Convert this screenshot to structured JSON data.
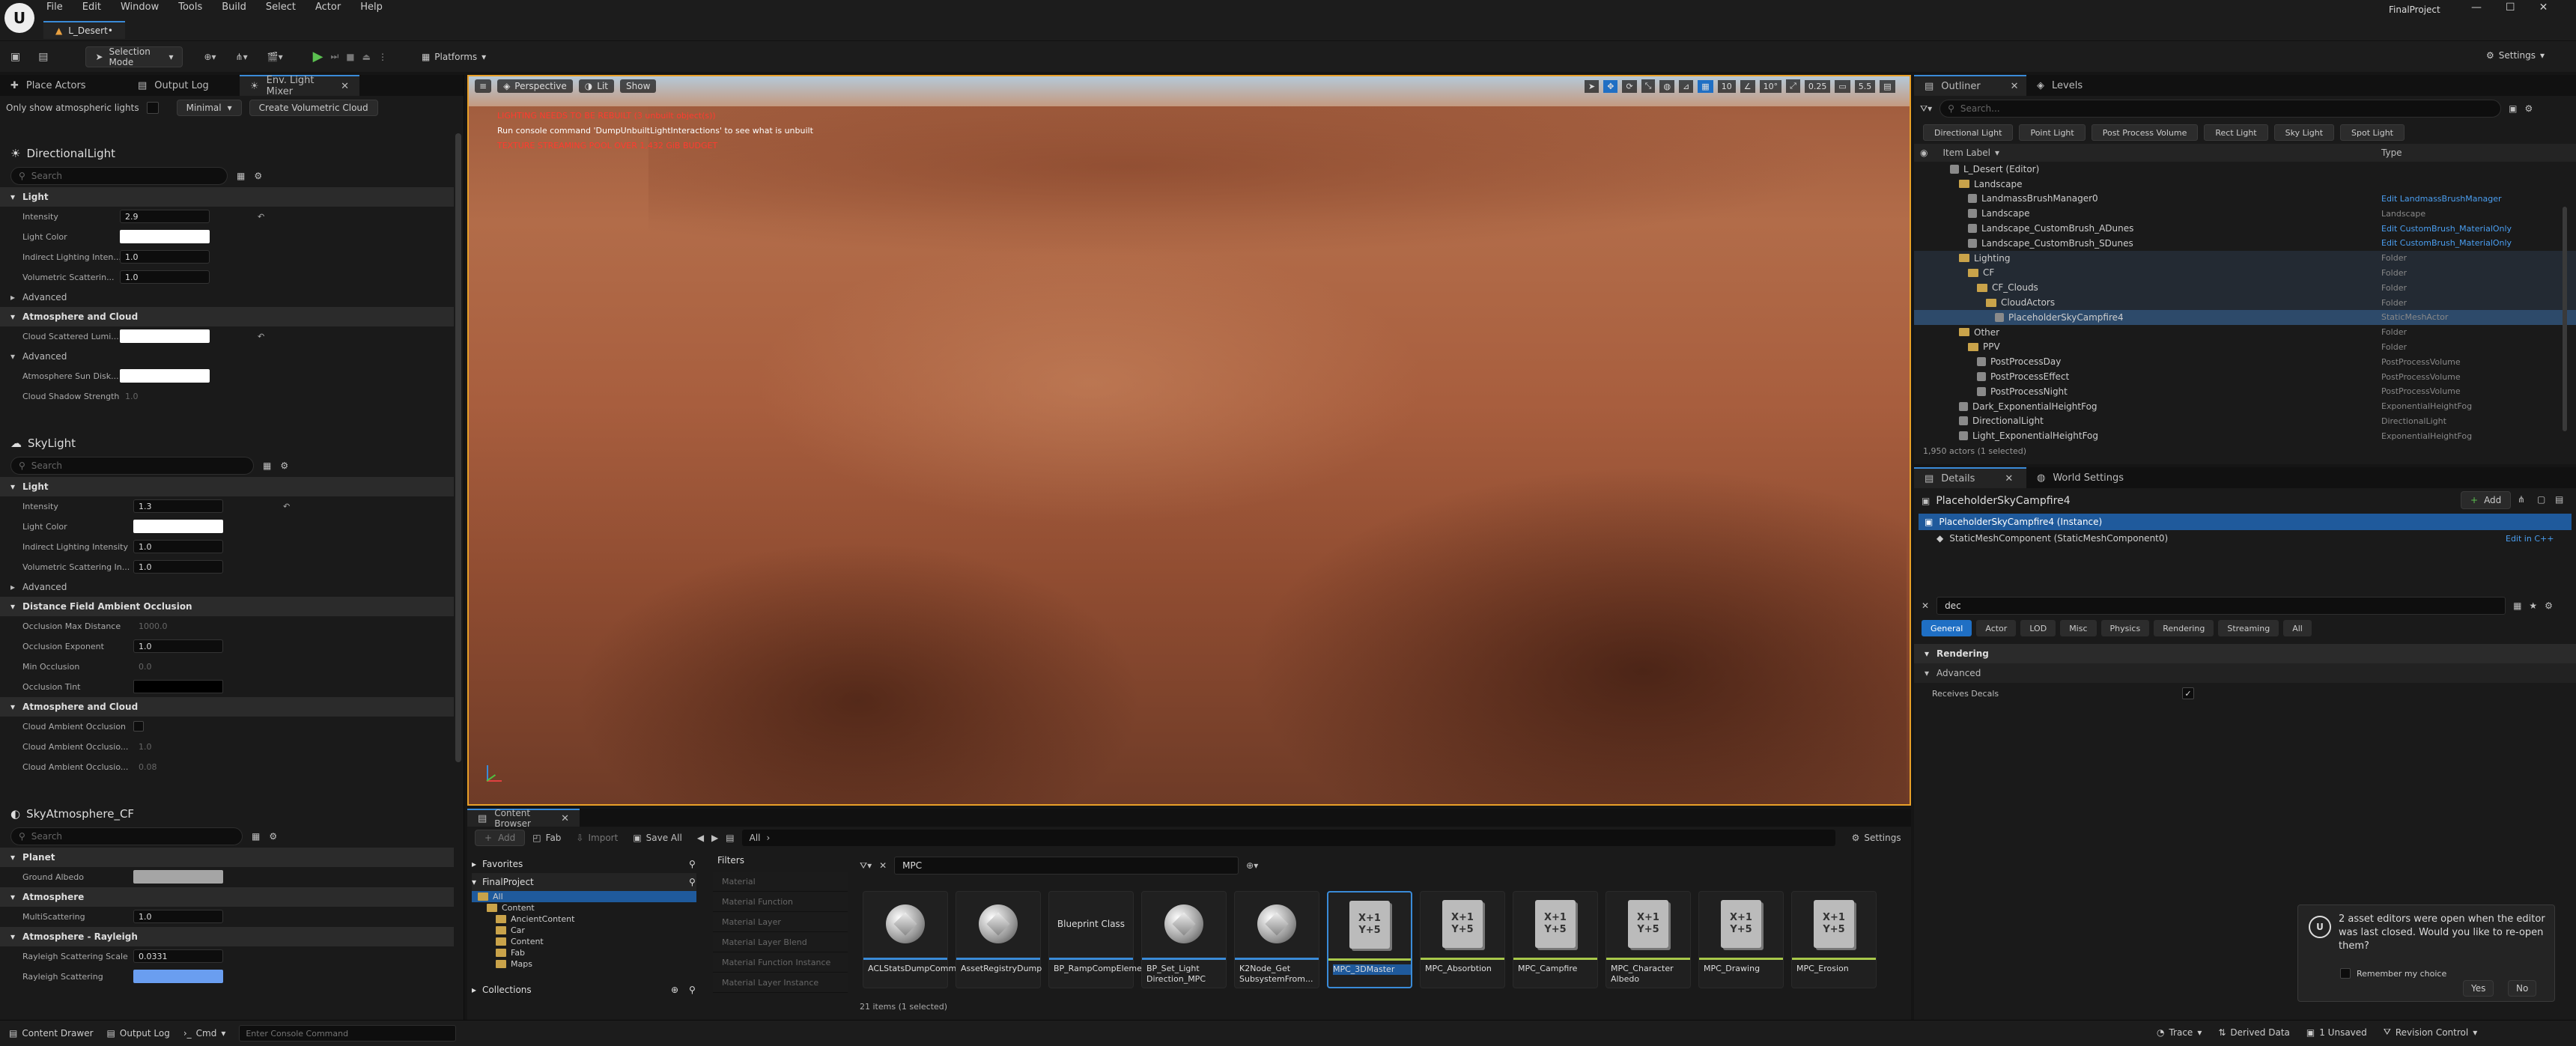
{
  "menu": [
    "File",
    "Edit",
    "Window",
    "Tools",
    "Build",
    "Select",
    "Actor",
    "Help"
  ],
  "level_tab": "L_Desert•",
  "project_name": "FinalProject",
  "toolbar": {
    "selection_mode": "Selection Mode",
    "platforms": "Platforms",
    "settings": "Settings"
  },
  "left_tabs": [
    "Place Actors",
    "Output Log",
    "Env. Light Mixer"
  ],
  "left_opts": {
    "atmo_label": "Only show atmospheric lights",
    "minimal": "Minimal",
    "create_cloud": "Create Volumetric Cloud"
  },
  "directional": {
    "title": "DirectionalLight",
    "search": "Search",
    "light": "Light",
    "props": [
      {
        "label": "Intensity",
        "value": "2.9"
      },
      {
        "label": "Light Color",
        "value": ""
      },
      {
        "label": "Indirect Lighting Inten...",
        "value": "1.0"
      },
      {
        "label": "Volumetric Scatterin...",
        "value": "1.0"
      }
    ],
    "advanced": "Advanced",
    "atmo_cloud": "Atmosphere and Cloud",
    "cloud_props": [
      {
        "label": "Cloud Scattered Lumi...",
        "value": ""
      }
    ],
    "advanced2": "Advanced",
    "sun_props": [
      {
        "label": "Atmosphere Sun Disk...",
        "value": ""
      },
      {
        "label": "Cloud Shadow Strength",
        "value": "1.0"
      }
    ]
  },
  "skylight": {
    "title": "SkyLight",
    "search": "Search",
    "light": "Light",
    "props": [
      {
        "label": "Intensity",
        "value": "1.3"
      },
      {
        "label": "Light Color",
        "value": ""
      },
      {
        "label": "Indirect Lighting Intensity",
        "value": "1.0"
      },
      {
        "label": "Volumetric Scattering In...",
        "value": "1.0"
      }
    ],
    "advanced": "Advanced",
    "dfao": "Distance Field Ambient Occlusion",
    "dfao_props": [
      {
        "label": "Occlusion Max Distance",
        "value": "1000.0"
      },
      {
        "label": "Occlusion Exponent",
        "value": "1.0"
      },
      {
        "label": "Min Occlusion",
        "value": "0.0"
      },
      {
        "label": "Occlusion Tint",
        "value": ""
      }
    ],
    "atmo_cloud": "Atmosphere and Cloud",
    "cloud_props": [
      {
        "label": "Cloud Ambient Occlusion",
        "value": ""
      },
      {
        "label": "Cloud Ambient Occlusio...",
        "value": "1.0"
      },
      {
        "label": "Cloud Ambient Occlusio...",
        "value": "0.08"
      }
    ]
  },
  "skyatmo": {
    "title": "SkyAtmosphere_CF",
    "search": "Search",
    "planet": "Planet",
    "ground_albedo": "Ground Albedo",
    "atmosphere": "Atmosphere",
    "multi_scat": {
      "label": "MultiScattering",
      "value": "1.0"
    },
    "rayleigh": "Atmosphere - Rayleigh",
    "rayleigh_scale": {
      "label": "Rayleigh Scattering Scale",
      "value": "0.0331"
    },
    "rayleigh_scat": {
      "label": "Rayleigh Scattering",
      "value": ""
    }
  },
  "viewport": {
    "perspective": "Perspective",
    "lit": "Lit",
    "show": "Show",
    "msg1": "LIGHTING NEEDS TO BE REBUILT (3 unbuilt object(s))",
    "msg2": "Run console command 'DumpUnbuiltLightInteractions' to see what is unbuilt",
    "msg3": "TEXTURE STREAMING POOL OVER 1,432 GiB BUDGET",
    "snap_grid": "10",
    "snap_angle": "10°",
    "snap_scale": "0.25",
    "cam_speed": "5.5"
  },
  "outliner": {
    "tabs": [
      "Outliner",
      "Levels"
    ],
    "search": "Search...",
    "filters": [
      "Directional Light",
      "Point Light",
      "Post Process Volume",
      "Rect Light",
      "Sky Light",
      "Spot Light"
    ],
    "col_label": "Item Label",
    "col_type": "Type",
    "items": [
      {
        "label": "L_Desert (Editor)",
        "type": "",
        "link": false
      },
      {
        "label": "Landscape",
        "type": "",
        "link": false
      },
      {
        "label": "LandmassBrushManager0",
        "type": "Edit LandmassBrushManager",
        "link": true
      },
      {
        "label": "Landscape",
        "type": "Landscape",
        "link": false
      },
      {
        "label": "Landscape_CustomBrush_ADunes",
        "type": "Edit CustomBrush_MaterialOnly",
        "link": true
      },
      {
        "label": "Landscape_CustomBrush_SDunes",
        "type": "Edit CustomBrush_MaterialOnly",
        "link": true
      },
      {
        "label": "Lighting",
        "type": "Folder",
        "link": false
      },
      {
        "label": "CF",
        "type": "Folder",
        "link": false
      },
      {
        "label": "CF_Clouds",
        "type": "Folder",
        "link": false
      },
      {
        "label": "CloudActors",
        "type": "Folder",
        "link": false
      },
      {
        "label": "PlaceholderSkyCampfire4",
        "type": "StaticMeshActor",
        "link": false
      },
      {
        "label": "Other",
        "type": "Folder",
        "link": false
      },
      {
        "label": "PPV",
        "type": "Folder",
        "link": false
      },
      {
        "label": "PostProcessDay",
        "type": "PostProcessVolume",
        "link": false
      },
      {
        "label": "PostProcessEffect",
        "type": "PostProcessVolume",
        "link": false
      },
      {
        "label": "PostProcessNight",
        "type": "PostProcessVolume",
        "link": false
      },
      {
        "label": "Dark_ExponentialHeightFog",
        "type": "ExponentialHeightFog",
        "link": false
      },
      {
        "label": "DirectionalLight",
        "type": "DirectionalLight",
        "link": false
      },
      {
        "label": "Light_ExponentialHeightFog",
        "type": "ExponentialHeightFog",
        "link": false
      }
    ],
    "status": "1,950 actors (1 selected)"
  },
  "details": {
    "tabs": [
      "Details",
      "World Settings"
    ],
    "actor": "PlaceholderSkyCampfire4",
    "add": "Add",
    "instance": "PlaceholderSkyCampfire4 (Instance)",
    "component": "StaticMeshComponent (StaticMeshComponent0)",
    "edit_cpp": "Edit in C++",
    "search_value": "dec",
    "filter_tabs": [
      "General",
      "Actor",
      "LOD",
      "Misc",
      "Physics",
      "Rendering",
      "Streaming",
      "All"
    ],
    "rendering": "Rendering",
    "advanced": "Advanced",
    "receives_decals": "Receives Decals"
  },
  "content_browser": {
    "tab": "Content Browser",
    "add": "Add",
    "fab": "Fab",
    "import": "Import",
    "save_all": "Save All",
    "path": "All",
    "settings": "Settings",
    "favorites": "Favorites",
    "project": "FinalProject",
    "folders": [
      "All",
      "Content",
      "AncientContent",
      "Car",
      "Content",
      "Fab",
      "Maps"
    ],
    "collections": "Collections",
    "filters_title": "Filters",
    "filters": [
      "Material",
      "Material Function",
      "Material Layer",
      "Material Layer Blend",
      "Material Function Instance",
      "Material Layer Instance"
    ],
    "search_value": "MPC",
    "assets": [
      {
        "name": "ACLStatsDumpCommandlet",
        "kind": "sphere",
        "bar": "#3a8bd8"
      },
      {
        "name": "AssetRegistryDump",
        "kind": "sphere",
        "bar": "#3a8bd8"
      },
      {
        "name": "BP_RampCompElement",
        "kind": "text",
        "bar": "#3a8bd8",
        "thumb": "Blueprint Class"
      },
      {
        "name": "BP_Set_Light Direction_MPC",
        "kind": "sphere",
        "bar": "#3a8bd8"
      },
      {
        "name": "K2Node_Get SubsystemFrom...",
        "kind": "sphere",
        "bar": "#3a8bd8"
      },
      {
        "name": "MPC_3DMaster",
        "kind": "mpc",
        "bar": "#a8c84a",
        "selected": true
      },
      {
        "name": "MPC_Absorbtion",
        "kind": "mpc",
        "bar": "#a8c84a"
      },
      {
        "name": "MPC_Campfire",
        "kind": "mpc",
        "bar": "#a8c84a"
      },
      {
        "name": "MPC_Character Albedo",
        "kind": "mpc",
        "bar": "#a8c84a"
      },
      {
        "name": "MPC_Drawing",
        "kind": "mpc",
        "bar": "#a8c84a"
      },
      {
        "name": "MPC_Erosion",
        "kind": "mpc",
        "bar": "#a8c84a"
      }
    ],
    "mpc_thumb": "X+1\nY+5",
    "count": "21 items (1 selected)"
  },
  "toast": {
    "message": "2 asset editors were open when the editor was last closed. Would you like to re-open them?",
    "remember": "Remember my choice",
    "yes": "Yes",
    "no": "No"
  },
  "statusbar": {
    "content_drawer": "Content Drawer",
    "output_log": "Output Log",
    "cmd": "Cmd",
    "console_placeholder": "Enter Console Command",
    "trace": "Trace",
    "derived_data": "Derived Data",
    "unsaved": "1 Unsaved",
    "revision": "Revision Control"
  }
}
